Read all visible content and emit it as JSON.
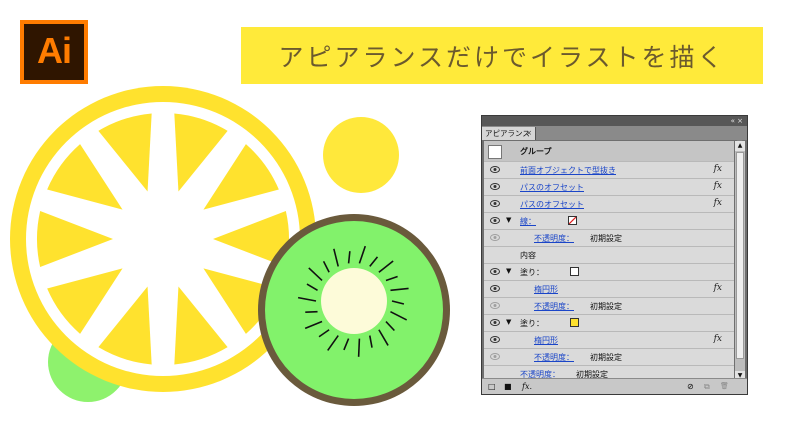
{
  "logo": {
    "text": "Ai"
  },
  "banner": {
    "title": "アピアランスだけでイラストを描く"
  },
  "colors": {
    "lemon": "#ffe22e",
    "lemon_light": "#ffe83b",
    "lime_circle": "#8ef26d",
    "kiwi_green": "#82f26b",
    "kiwi_border": "#6a5a3c",
    "kiwi_center": "#fdfbd9"
  },
  "panel": {
    "tab_label": "アピアランス",
    "tab_close": "×",
    "top_controls": "«  ×",
    "menu_icon": "≡",
    "rows": [
      {
        "kind": "group",
        "label": "グループ"
      },
      {
        "kind": "effect",
        "label": "前面オブジェクトで型抜き",
        "fx": "fx"
      },
      {
        "kind": "effect",
        "label": "パスのオフセット",
        "fx": "fx"
      },
      {
        "kind": "effect",
        "label": "パスのオフセット",
        "fx": "fx"
      },
      {
        "kind": "stroke",
        "label": "線："
      },
      {
        "kind": "opacity",
        "label": "不透明度：",
        "value": "初期設定"
      },
      {
        "kind": "content",
        "label": "内容"
      },
      {
        "kind": "fill",
        "label": "塗り：",
        "swatch": "white"
      },
      {
        "kind": "shape",
        "label": "楕円形",
        "fx": "fx"
      },
      {
        "kind": "opacity",
        "label": "不透明度：",
        "value": "初期設定"
      },
      {
        "kind": "fill",
        "label": "塗り：",
        "swatch": "yellow"
      },
      {
        "kind": "shape",
        "label": "楕円形",
        "fx": "fx"
      },
      {
        "kind": "opacity",
        "label": "不透明度：",
        "value": "初期設定"
      },
      {
        "kind": "opacity-partial",
        "label": "不透明度：",
        "value": "初期設定"
      }
    ],
    "bottom": {
      "new_stroke": "□",
      "new_fill": "■",
      "fx_button": "fx.",
      "clear": "⊘",
      "duplicate": "⧉",
      "delete": "🗑"
    }
  }
}
